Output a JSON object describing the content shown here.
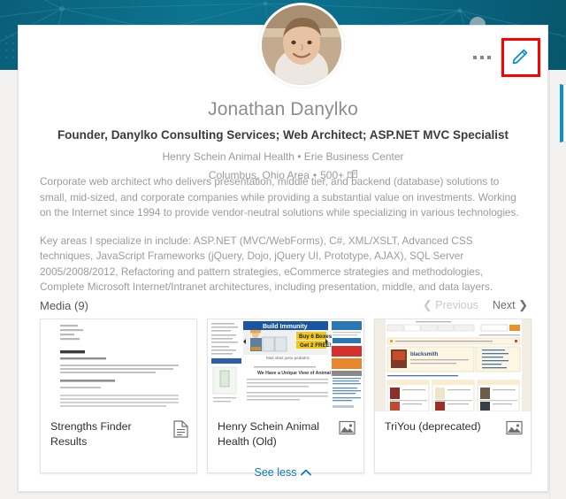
{
  "theme": {
    "banner_color": "#0d7490",
    "link_color": "#0b78b7",
    "highlight_color": "#ff0000",
    "edit_icon_color": "#0a8fd0",
    "page_bg": "#f3f2f0"
  },
  "profile": {
    "full_name": "Jonathan Danylko",
    "headline": "Founder, Danylko Consulting Services; Web Architect; ASP.NET MVC Specialist",
    "company_line": "Henry Schein Animal Health • Erie Business Center",
    "location": "Columbus, Ohio Area",
    "separator": "•",
    "connections": "500+",
    "connections_icon": "connections-icon",
    "avatar_icon": "profile-photo",
    "summary_paragraphs": [
      "Corporate web architect who delivers presentation, middle tier, and backend (database) solutions to small, mid-sized, and corporate companies while providing a substantial value on investments. Working on the Internet since 1994 to provide vendor-neutral solutions while specializing in various technologies.",
      "Key areas I specialize in include: ASP.NET (MVC/WebForms), C#, XML/XSLT, Advanced CSS techniques, JavaScript Frameworks (jQuery, Dojo, jQuery UI, Prototype, AJAX), SQL Server 2005/2008/2012, Refactoring and pattern strategies, eCommerce strategies and methodologies, Complete Microsoft Internet/Intranet architectures, including presentation, middle, and data layers."
    ]
  },
  "actions": {
    "more_icon": "ellipsis-icon",
    "more_label": "...",
    "edit_icon": "pencil-edit-icon",
    "edit_label": "Edit profile"
  },
  "media": {
    "section_title": "Media (9)",
    "count": 9,
    "previous_label": "Previous",
    "previous_chevron": "❮",
    "previous_enabled": false,
    "next_label": "Next",
    "next_chevron": "❯",
    "next_enabled": true,
    "items": [
      {
        "title": "Strengths Finder Results",
        "type": "document",
        "type_icon": "document-icon",
        "thumb": "document-page-thumbnail"
      },
      {
        "title": "Henry Schein Animal Health (Old)",
        "type": "image",
        "type_icon": "image-icon",
        "thumb": "website-screenshot-thumbnail"
      },
      {
        "title": "TriYou (deprecated)",
        "type": "image",
        "type_icon": "image-icon",
        "thumb": "website-screenshot-thumbnail"
      }
    ]
  },
  "footer": {
    "see_less_label": "See less",
    "see_less_chevron": "⌃"
  }
}
